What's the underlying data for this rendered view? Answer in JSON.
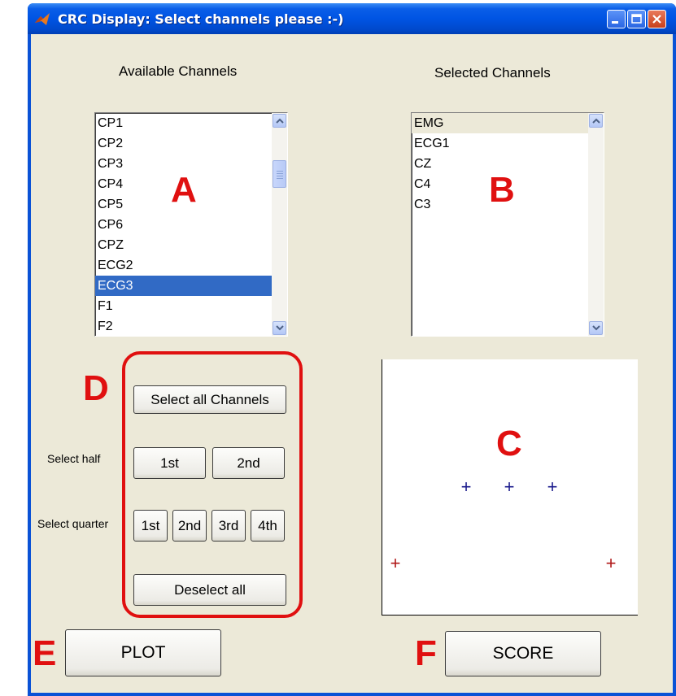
{
  "window": {
    "title": "CRC Display: Select channels please :-)",
    "controls": [
      "minimize-icon",
      "maximize-icon",
      "close-icon"
    ]
  },
  "available": {
    "label": "Available Channels",
    "items": [
      "CP1",
      "CP2",
      "CP3",
      "CP4",
      "CP5",
      "CP6",
      "CPZ",
      "ECG2",
      "ECG3",
      "F1",
      "F2"
    ],
    "selected_item": "ECG3"
  },
  "selected": {
    "label": "Selected Channels",
    "items": [
      "EMG",
      "ECG1",
      "CZ",
      "C4",
      "C3"
    ]
  },
  "selection": {
    "select_all_label": "Select all Channels",
    "half_label": "Select half",
    "half_buttons": [
      "1st",
      "2nd"
    ],
    "quarter_label": "Select quarter",
    "quarter_buttons": [
      "1st",
      "2nd",
      "3rd",
      "4th"
    ],
    "deselect_label": "Deselect all"
  },
  "actions": {
    "plot_label": "PLOT",
    "score_label": "SCORE"
  },
  "annotations": {
    "A": "A",
    "B": "B",
    "C": "C",
    "D": "D",
    "E": "E",
    "F": "F",
    "color": "#e01010"
  },
  "electrode_plot": {
    "markers": [
      {
        "symbol": "+",
        "color": "#1a1a8c"
      },
      {
        "symbol": "+",
        "color": "#1a1a8c"
      },
      {
        "symbol": "+",
        "color": "#1a1a8c"
      },
      {
        "symbol": "+",
        "color": "#b01818"
      },
      {
        "symbol": "+",
        "color": "#b01818"
      }
    ]
  },
  "colors": {
    "titlebar": "#0054e3",
    "client_bg": "#ece9d8",
    "list_selection": "#316ac5"
  }
}
